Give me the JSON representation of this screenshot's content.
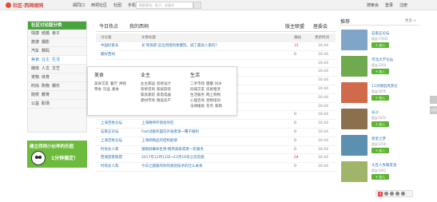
{
  "header": {
    "logo_text": "社区·西祠胡同",
    "nav": [
      "胡同口",
      "西祠社区",
      "社团",
      "手机版"
    ],
    "search_placeholder": "搜索版块、帖子、关键词",
    "right": [
      "搜索会",
      "登录",
      "注册"
    ]
  },
  "categories": {
    "title": "社区讨论版分类",
    "rows": [
      [
        "情感",
        "结婚",
        "亲子"
      ],
      [
        "旅游",
        "摄影"
      ],
      [
        "汽车",
        "数码"
      ],
      [
        "美食",
        "业主",
        "生活"
      ],
      [
        "媒体",
        "人文",
        "文艺"
      ],
      [
        "宠物",
        "体育"
      ],
      [
        "时尚",
        "购物",
        "娱乐"
      ],
      [
        "院校",
        "教育"
      ],
      [
        "公益",
        "职场"
      ]
    ],
    "active_index": 3
  },
  "promo": {
    "line1": "建立西祠小伙伴的乐园",
    "line2": "1分钟搞定！"
  },
  "tabs": {
    "left": [
      "今日热点",
      "我的西祠"
    ],
    "right": [
      "版主联盟",
      "居委会"
    ]
  },
  "table": {
    "headers": [
      "讨论版",
      "文章标题",
      "跟帖",
      "更新时间"
    ],
    "rows": [
      {
        "forum": "中国好家长",
        "title": "长'等探索'这位周围的保健院，城了最高人家的？",
        "count": "31",
        "hot": true,
        "time": "16:44"
      },
      {
        "forum": "最好西祠",
        "title": "",
        "count": "0",
        "hot": false,
        "time": "16:44"
      },
      {
        "forum": "",
        "title": "",
        "count": "",
        "hot": false,
        "time": "16:44"
      },
      {
        "forum": "",
        "title": "",
        "count": "",
        "hot": false,
        "time": "16:44"
      },
      {
        "forum": "",
        "title": "",
        "count": "",
        "hot": false,
        "time": "16:44"
      },
      {
        "forum": "",
        "title": "",
        "count": "",
        "hot": false,
        "time": "16:44"
      },
      {
        "forum": "",
        "title": "",
        "count": "",
        "hot": false,
        "time": "16:44"
      },
      {
        "forum": "",
        "title": "",
        "count": "",
        "hot": false,
        "time": "16:44"
      },
      {
        "forum": "时尚女人帮",
        "title": "内附件总情感的要点知识",
        "count": "0",
        "hot": false,
        "time": "16:44"
      },
      {
        "forum": "上海百姓论坛",
        "title": "上海精神环境指导区",
        "count": "0",
        "hot": false,
        "time": "16:44"
      },
      {
        "forum": "石家庄论坛",
        "title": "Fast试服务面向外张者请一覆子报附",
        "count": "0",
        "hot": false,
        "time": "16:44"
      },
      {
        "forum": "上海百姓论坛",
        "title": "上海修精品的结构能够",
        "count": "0",
        "hot": false,
        "time": "16:44"
      },
      {
        "forum": "时尚女人帮",
        "title": "锁眼屏幕体生感·精简高级或者一轮服务",
        "count": "0",
        "hot": false,
        "time": "16:44"
      },
      {
        "forum": "西湖游客联盟",
        "title": "2017年12月11日→12月16日之前答题",
        "count": "04",
        "hot": true,
        "time": "16:44"
      },
      {
        "forum": "时尚女人帮",
        "title": "今日之题服的你的规划技术的仕么关系",
        "count": "0",
        "hot": false,
        "time": "16:44"
      }
    ]
  },
  "dropdown": {
    "columns": [
      {
        "title": "美食",
        "lines": [
          [
            "美食交友",
            "餐厅",
            "烘焙"
          ],
          [
            "零食",
            "饮品",
            "素食"
          ]
        ]
      },
      {
        "title": "业主",
        "lines": [
          [
            "业主家园",
            "装修设计"
          ],
          [
            "装修咨询",
            "家居软装"
          ],
          [
            "家具家纺",
            "家电电器"
          ],
          [
            "建材市场",
            "精美房产"
          ]
        ]
      },
      {
        "title": "生活",
        "lines": [
          [
            "二手市场",
            "健康",
            "同乡"
          ],
          [
            "同城交友",
            "房屋租赁"
          ],
          [
            "生活服务",
            "网上购物"
          ],
          [
            "心理咨询",
            "宠物培训"
          ],
          [
            "法律援助",
            "花鸟",
            "家政"
          ]
        ]
      }
    ]
  },
  "recommend": {
    "title": "推荐",
    "more": "更多 >",
    "join_label": "+ 加入",
    "items": [
      {
        "name": "石家庄论坛",
        "count": "版友17832",
        "color": "#7fa6c8"
      },
      {
        "name": "河北大学论坛",
        "count": "版友1264",
        "color": "#6faa4f"
      },
      {
        "name": "11对情侣风景论",
        "count": "版友1876",
        "color": "#d06a4a"
      },
      {
        "name": "长沙",
        "count": "版友1872",
        "color": "#8c6f4d"
      },
      {
        "name": "星星之梦",
        "count": "版友1256",
        "color": "#5c8fb0"
      },
      {
        "name": "大连人失联友会",
        "count": "版友1041",
        "color": "#a0b46a"
      }
    ]
  },
  "side": {
    "feedback": "反馈"
  },
  "ime": {
    "logo": "S"
  }
}
